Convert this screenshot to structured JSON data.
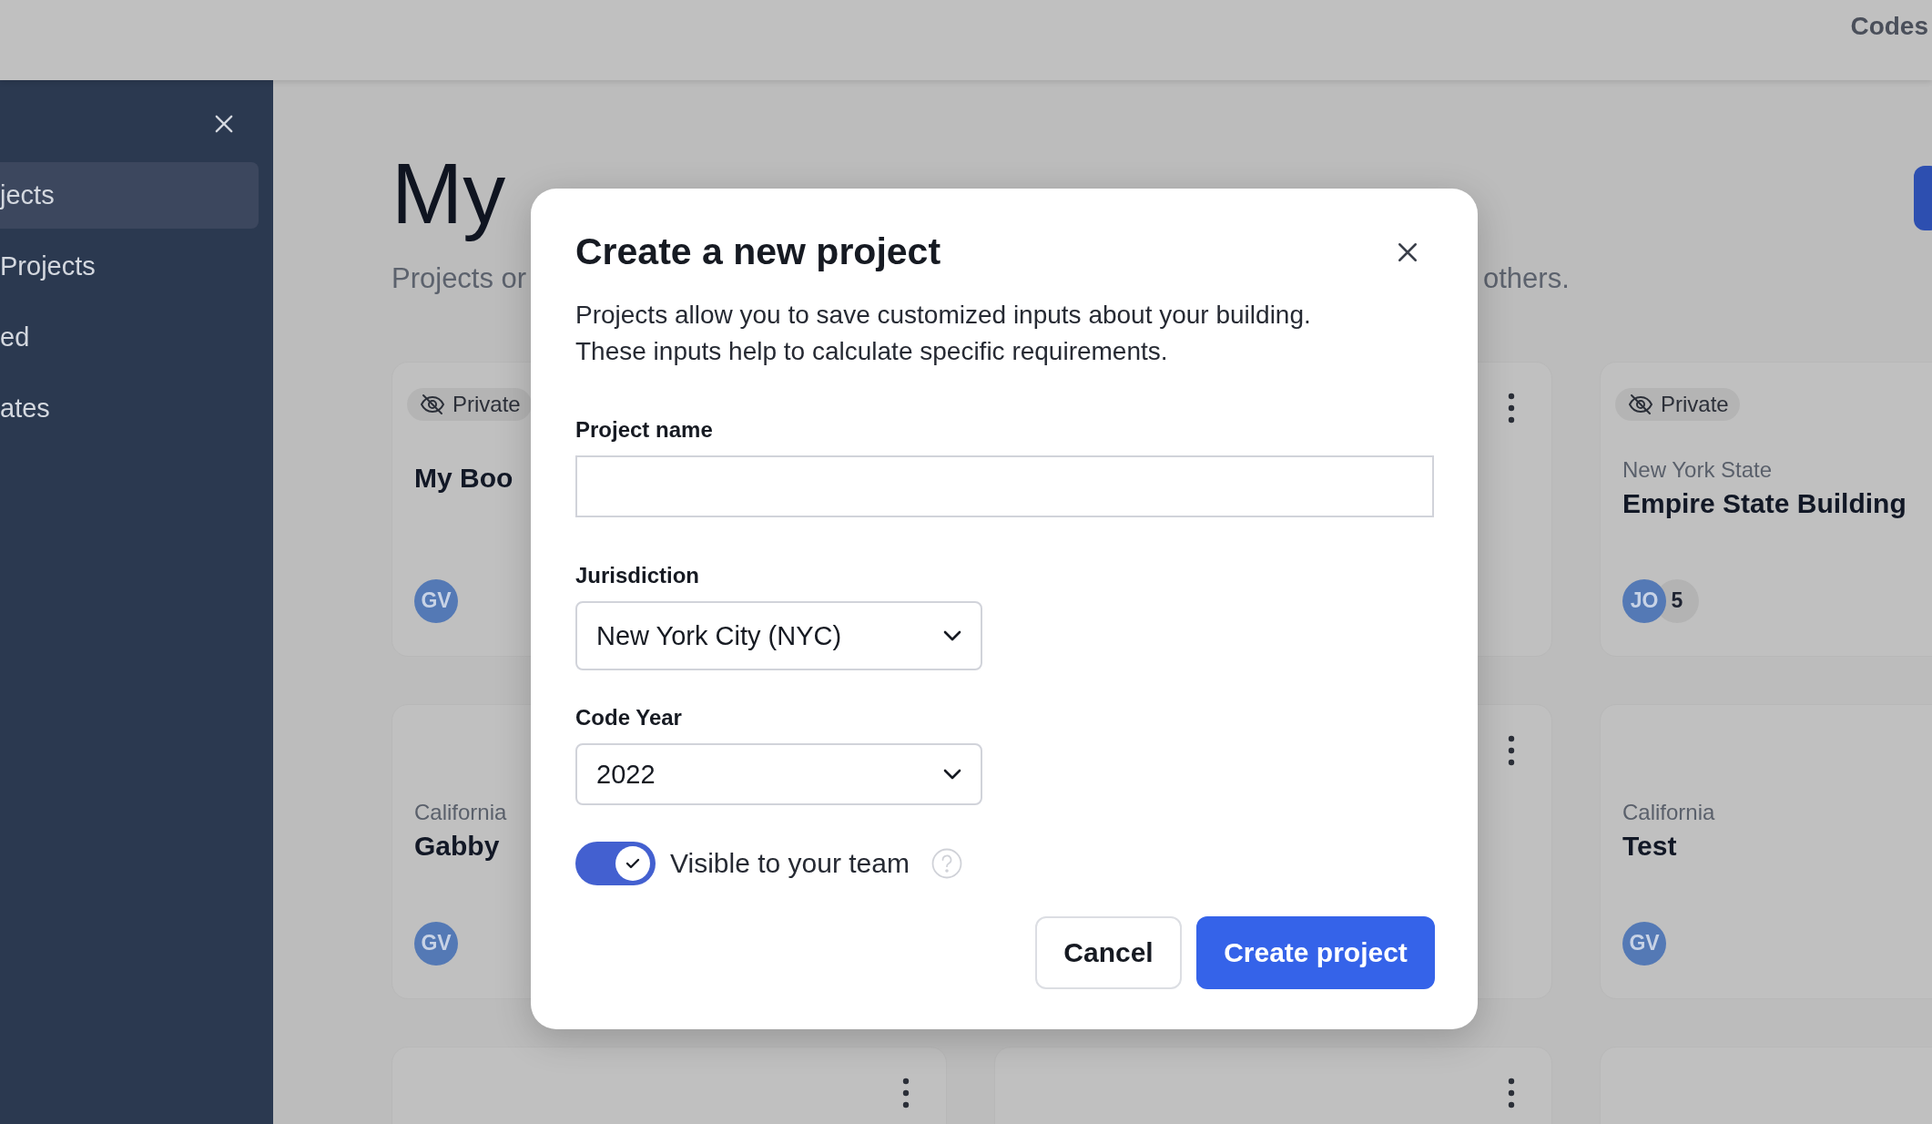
{
  "topbar": {
    "link": "Codes"
  },
  "sidebar": {
    "items": [
      {
        "label": "jects",
        "selected": true
      },
      {
        "label": "Projects",
        "selected": false
      },
      {
        "label": "ed",
        "selected": false
      },
      {
        "label": "ates",
        "selected": false
      }
    ]
  },
  "page": {
    "title": "My",
    "subtitle_start": "Projects or",
    "subtitle_end": "others."
  },
  "cards": [
    {
      "badge": "Private",
      "name": "My Boo",
      "avatars": [
        "GV"
      ],
      "menu": false
    },
    {
      "menu": true
    },
    {
      "badge": "Private",
      "location": "New York State",
      "name": "Empire State Building",
      "avatars": [
        "JO"
      ],
      "count": "5",
      "menu": false
    },
    {
      "location": "California",
      "name": "Gabby",
      "avatars": [
        "GV"
      ],
      "menu": false
    },
    {
      "menu": true
    },
    {
      "location": "California",
      "name": "Test",
      "avatars": [
        "GV"
      ],
      "menu": false
    },
    {
      "menu": true
    },
    {
      "menu": true
    },
    {
      "menu": false
    }
  ],
  "modal": {
    "title": "Create a new project",
    "description": [
      "Projects allow you to save customized inputs about your building.",
      "These inputs help to calculate specific requirements."
    ],
    "fields": [
      {
        "kind": "text",
        "label": "Project name"
      },
      {
        "kind": "select",
        "label": "Jurisdiction",
        "value": "New York City (NYC)"
      },
      {
        "kind": "select",
        "label": "Code Year",
        "value": "2022"
      }
    ],
    "toggle": {
      "label": "Visible to your team",
      "on": true
    },
    "buttons": [
      {
        "label": "Cancel",
        "kind": "secondary"
      },
      {
        "label": "Create project",
        "kind": "primary"
      }
    ]
  }
}
